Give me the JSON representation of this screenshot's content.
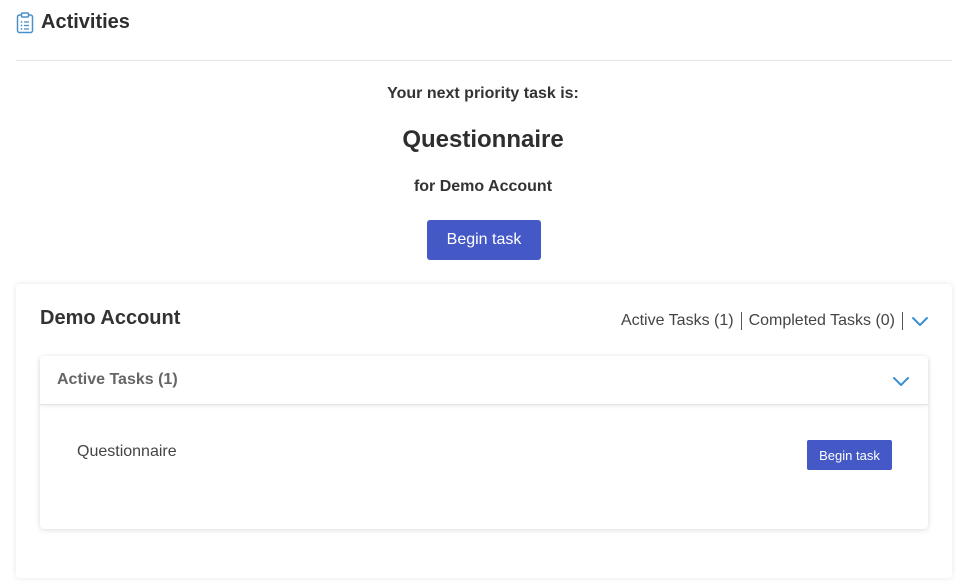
{
  "header": {
    "title": "Activities",
    "icon": "clipboard-icon",
    "icon_color": "#4a90c8"
  },
  "priority": {
    "label": "Your next priority task is:",
    "task_name": "Questionnaire",
    "account_line": "for Demo Account",
    "button_label": "Begin task"
  },
  "account": {
    "name": "Demo Account",
    "active_tasks_link": "Active Tasks (1)",
    "completed_tasks_link": "Completed Tasks (0)",
    "toggle_icon": "chevron-down-icon"
  },
  "active_panel": {
    "title": "Active Tasks (1)",
    "toggle_icon": "chevron-down-icon",
    "tasks": [
      {
        "name": "Questionnaire",
        "button_label": "Begin task"
      }
    ]
  },
  "colors": {
    "primary_button": "#4458c6",
    "accent_chevron": "#3a8fd0"
  }
}
